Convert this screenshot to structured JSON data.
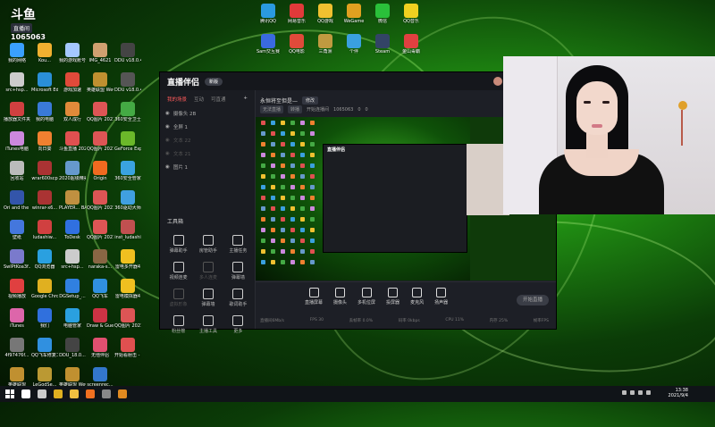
{
  "logo": {
    "mark": "斗鱼",
    "tag": "直播间",
    "room_number": "1065063"
  },
  "desktop_icons_left": [
    {
      "label": "我的网络",
      "color": "#3aa0ff"
    },
    {
      "label": "Kou...",
      "color": "#f0b030"
    },
    {
      "label": "我的游戏账号",
      "color": "#a4c8ff"
    },
    {
      "label": "IMG_4621",
      "color": "#d0a070"
    },
    {
      "label": "DDU v18.0.4.2",
      "color": "#444"
    },
    {
      "label": "src+hsp...",
      "color": "#ccc"
    },
    {
      "label": "Microsoft Edge",
      "color": "#2a8fd8"
    },
    {
      "label": "游戏加速",
      "color": "#e04a3a"
    },
    {
      "label": "英雄联盟 WeGame版",
      "color": "#c09030"
    },
    {
      "label": "DDU v18.0.4.2",
      "color": "#555"
    },
    {
      "label": "播放器文件夹 无法PPT",
      "color": "#d04040"
    },
    {
      "label": "我的电脑",
      "color": "#3a7ad8"
    },
    {
      "label": "双人成行",
      "color": "#e08a3a"
    },
    {
      "label": "QQ图片 2021050...",
      "color": "#dd5555"
    },
    {
      "label": "360安全卫士",
      "color": "#44aa44"
    },
    {
      "label": "iTunes电脑",
      "color": "#cc88dd"
    },
    {
      "label": "向日葵",
      "color": "#f08030"
    },
    {
      "label": "斗鱼直播 2021年9...",
      "color": "#e05050"
    },
    {
      "label": "QQ图片 2021050...",
      "color": "#dd5555"
    },
    {
      "label": "GeForce Experience",
      "color": "#6bb82a"
    },
    {
      "label": "回收站",
      "color": "#bbb"
    },
    {
      "label": "wrar600scp",
      "color": "#aa3333"
    },
    {
      "label": "2020超级精美 壁纸.jpg",
      "color": "#6699cc"
    },
    {
      "label": "Origin",
      "color": "#f06a20"
    },
    {
      "label": "360安全管家",
      "color": "#3aa3e0"
    },
    {
      "label": "Ori and the Will of th...",
      "color": "#3355aa"
    },
    {
      "label": "winrar-x6...",
      "color": "#aa3333"
    },
    {
      "label": "PLAYER... BATTLEGR...",
      "color": "#c09040"
    },
    {
      "label": "QQ图片 2021050...",
      "color": "#dd5555"
    },
    {
      "label": "360驱动大师",
      "color": "#40a0e0"
    },
    {
      "label": "壁纸",
      "color": "#4477dd"
    },
    {
      "label": "ludashiw...",
      "color": "#d04040"
    },
    {
      "label": "ToDesk",
      "color": "#3070e0"
    },
    {
      "label": "QQ图片 2021070...",
      "color": "#dd5555"
    },
    {
      "label": "inst_ludashi",
      "color": "#c05050"
    },
    {
      "label": "SwIPtKoa3f...",
      "color": "#7a7acc"
    },
    {
      "label": "QQ浏览器",
      "color": "#2aa0e0"
    },
    {
      "label": "src+hsp...",
      "color": "#ccc"
    },
    {
      "label": "naraka-s...",
      "color": "#886644"
    },
    {
      "label": "雷电多开器4",
      "color": "#f0c020"
    },
    {
      "label": "视频播放",
      "color": "#e04040"
    },
    {
      "label": "Google Chrome",
      "color": "#e0b020"
    },
    {
      "label": "DGSetup_...",
      "color": "#3080e0"
    },
    {
      "label": "QQ飞车",
      "color": "#3090e0"
    },
    {
      "label": "雷电模拟器4",
      "color": "#f0c020"
    },
    {
      "label": "iTunes",
      "color": "#dd66aa"
    },
    {
      "label": "我们",
      "color": "#3070dd"
    },
    {
      "label": "电脑管家",
      "color": "#2aa0e0"
    },
    {
      "label": "Draw & Guess",
      "color": "#cc3344"
    },
    {
      "label": "QQ图片 2021083...",
      "color": "#dd5555"
    },
    {
      "label": "4f97476f...",
      "color": "#777"
    },
    {
      "label": "QQ飞车修复工具",
      "color": "#3090e0"
    },
    {
      "label": "DDU_18.0...",
      "color": "#444"
    },
    {
      "label": "无他伴侣",
      "color": "#e05070"
    },
    {
      "label": "开始看射击 - 直播精彩",
      "color": "#e05050"
    },
    {
      "label": "英雄联盟",
      "color": "#c09030"
    },
    {
      "label": "LeGodSe...",
      "color": "#bb9933"
    },
    {
      "label": "英雄联盟 WeGame版",
      "color": "#c09030"
    },
    {
      "label": "screenrec...",
      "color": "#3377cc"
    }
  ],
  "desktop_icons_top": [
    {
      "label": "腾讯QQ",
      "color": "#2a9ae0"
    },
    {
      "label": "网易音乐",
      "color": "#e03a3a"
    },
    {
      "label": "QQ游戏",
      "color": "#f0c030"
    },
    {
      "label": "WeGame",
      "color": "#e0a020"
    },
    {
      "label": "微信",
      "color": "#2ac03a"
    },
    {
      "label": "QQ音乐",
      "color": "#f0d020"
    },
    {
      "label": "Sam交互赛",
      "color": "#3a6ae0"
    },
    {
      "label": "QQ电影",
      "color": "#e04a3a"
    },
    {
      "label": "三角洲",
      "color": "#c09a40"
    },
    {
      "label": "个伴",
      "color": "#3aa0e0"
    },
    {
      "label": "Steam",
      "color": "#334466"
    },
    {
      "label": "金山毒霸",
      "color": "#e04040"
    }
  ],
  "app": {
    "brand": "直播伴侣",
    "version_badge": "新版",
    "tabs": [
      "我的场景",
      "互动",
      "可直通"
    ],
    "scenes": [
      {
        "label": "摄像头 2B",
        "dim": false
      },
      {
        "label": "全屏 1",
        "dim": false
      },
      {
        "label": "文本 22",
        "dim": true
      },
      {
        "label": "文本 21",
        "dim": true
      },
      {
        "label": "图片 1",
        "dim": false
      }
    ],
    "tools_title": "工具箱",
    "tools": [
      {
        "label": "弹幕助手",
        "dim": false
      },
      {
        "label": "房管助手",
        "dim": false
      },
      {
        "label": "主播任务",
        "dim": false
      },
      {
        "label": "视频连麦",
        "dim": false
      },
      {
        "label": "多人连麦",
        "dim": true
      },
      {
        "label": "弹幕墙",
        "dim": false
      },
      {
        "label": "虚拟形象",
        "dim": true
      },
      {
        "label": "弹幕墙",
        "dim": false
      },
      {
        "label": "歌词助手",
        "dim": false
      },
      {
        "label": "粉丝榜",
        "dim": false
      },
      {
        "label": "主播工具",
        "dim": false
      },
      {
        "label": "更多",
        "dim": false
      }
    ],
    "stream_title": "永恒将至但是—",
    "edit_label": "修改",
    "meta": {
      "pill1": "无法直播",
      "pill2": "转播",
      "room_label": "开始连播间",
      "room_id": "1065063",
      "fans": "0",
      "share": "0"
    },
    "preview_brand": "直播伴侣",
    "bottom_tools": [
      "直播屏幕",
      "摄像头",
      "多机位屏",
      "投屏器",
      "麦克风",
      "扬声器"
    ],
    "start_button": "开始直播",
    "stats": [
      "直播间6Mb/s",
      "FPS 30",
      "丢帧率 0.0%",
      "码率 0kbps",
      "CPU 11%",
      "内存 25%",
      "帧率FPS"
    ],
    "window_controls": [
      "—",
      "□",
      "✕"
    ]
  },
  "webcam": {
    "caption": ""
  },
  "taskbar": {
    "apps": [
      {
        "name": "search",
        "color": "#ffffff"
      },
      {
        "name": "task-view",
        "color": "#cccccc"
      },
      {
        "name": "chrome",
        "color": "#e0b020"
      },
      {
        "name": "file-explorer",
        "color": "#f0c040"
      },
      {
        "name": "douyu",
        "color": "#f07020"
      },
      {
        "name": "obs",
        "color": "#888888"
      },
      {
        "name": "stream-assistant",
        "color": "#e08a20"
      }
    ],
    "time": "13:38",
    "date": "2021/9/4"
  },
  "colors": {
    "accent_red": "#ff5a5a",
    "desktop_green": "#1f8a12"
  }
}
